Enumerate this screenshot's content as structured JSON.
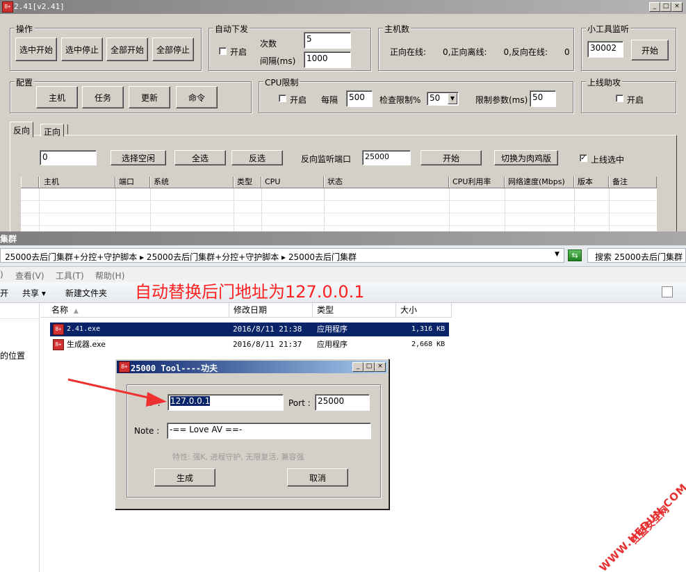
{
  "top_window": {
    "title": "2.41[v2.41]",
    "icon_text": "8+",
    "controls": {
      "minimize": "_",
      "maximize": "□",
      "close": "×"
    },
    "ops": {
      "label": "操作",
      "buttons": [
        "选中开始",
        "选中停止",
        "全部开始",
        "全部停止"
      ]
    },
    "auto": {
      "label": "自动下发",
      "enable": "开启",
      "count_label": "次数",
      "count_value": "5",
      "interval_label": "间隔(ms)",
      "interval_value": "1000"
    },
    "hosts": {
      "label": "主机数",
      "text": "正向在线:　　0,正向离线:　　0,反向在线:　　0"
    },
    "monitor": {
      "label": "小工具监听",
      "port": "30002",
      "start": "开始"
    },
    "config": {
      "label": "配置",
      "buttons": [
        "主机",
        "任务",
        "更新",
        "命令"
      ]
    },
    "cpu": {
      "label": "CPU限制",
      "enable": "开启",
      "every_label": "每隔",
      "every_value": "500",
      "check_label": "检查限制%",
      "check_value": "50",
      "param_label": "限制参数(ms)",
      "param_value": "50"
    },
    "online": {
      "label": "上线助攻",
      "enable": "开启"
    },
    "tabs": [
      "反向",
      "正向"
    ],
    "toolbar": {
      "count_value": "0",
      "select_idle": "选择空闲",
      "select_all": "全选",
      "invert": "反选",
      "port_label": "反向监听端口",
      "port_value": "25000",
      "start": "开始",
      "switch": "切换为肉鸡版",
      "online_select": "上线选中"
    },
    "columns": [
      "",
      "主机",
      "端口",
      "系统",
      "类型",
      "CPU",
      "状态",
      "CPU利用率",
      "网络速度(Mbps)",
      "版本",
      "备注"
    ]
  },
  "explorer": {
    "title": "集群",
    "breadcrumb": "25000去后门集群+分控+守护脚本 ▸ 25000去后门集群+分控+守护脚本 ▸ 25000去后门集群",
    "search_placeholder": "搜索 25000去后门集群",
    "menu": [
      "查看(V)",
      "工具(T)",
      "帮助(H)"
    ],
    "menu_left": ")",
    "cmd": {
      "open": "开",
      "share": "共享 ▾",
      "new_folder": "新建文件夹"
    },
    "annotation": "自动替换后门地址为127.0.0.1",
    "headers": {
      "name": "名称",
      "date": "修改日期",
      "type": "类型",
      "size": "大小"
    },
    "files": [
      {
        "name": "2.41.exe",
        "date": "2016/8/11 21:38",
        "type": "应用程序",
        "size": "1,316 KB"
      },
      {
        "name": "生成器.exe",
        "date": "2016/8/11 21:37",
        "type": "应用程序",
        "size": "2,668 KB"
      }
    ],
    "side_text": "的位置"
  },
  "dialog": {
    "title": "25000 Tool----功夫",
    "ip_label": "IP :",
    "ip_value": "127.0.0.1",
    "port_label": "Port :",
    "port_value": "25000",
    "note_label": "Note :",
    "note_value": "-== Love AV ==-",
    "features": "特性: 强K, 进程守护, 无限复活, 兼容强",
    "generate": "生成",
    "cancel": "取消"
  },
  "watermark": {
    "url": "WWW.HEDUN.COM",
    "cn": "红蓝安全网"
  },
  "colors": {
    "annotation": "#ff2020",
    "selection": "#0a246a",
    "arrow": "#ee3030"
  }
}
